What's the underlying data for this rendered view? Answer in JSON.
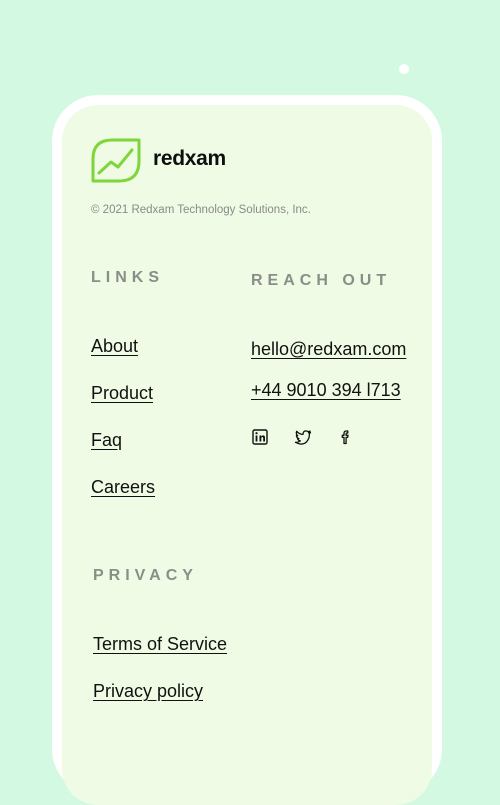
{
  "brand": {
    "name": "redxam",
    "accent_color": "#7ed63a",
    "logo_icon": "leaf-chart-icon"
  },
  "copyright": "© 2021 Redxam Technology Solutions, Inc.",
  "links": {
    "heading": "LINKS",
    "items": [
      "About",
      "Product",
      "Faq",
      "Careers"
    ]
  },
  "reach_out": {
    "heading": "REACH OUT",
    "email": "hello@redxam.com",
    "phone": "+44 9010 394 l713",
    "social_icons": [
      "linkedin-icon",
      "twitter-icon",
      "facebook-icon"
    ]
  },
  "privacy": {
    "heading": "PRIVACY",
    "items": [
      "Terms of Service",
      "Privacy policy"
    ]
  }
}
